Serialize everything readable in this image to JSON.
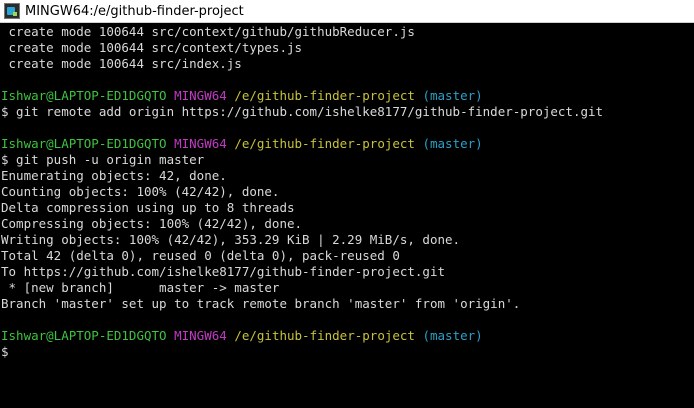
{
  "window": {
    "title": "MINGW64:/e/github-finder-project"
  },
  "colors": {
    "user": "#3fc23f",
    "system": "#c23ac2",
    "path": "#c8c23a",
    "branch": "#2aa0c8",
    "text": "#d9d9d9",
    "background": "#000000"
  },
  "terminal": {
    "commit_output": [
      " create mode 100644 src/context/github/githubReducer.js",
      " create mode 100644 src/context/types.js",
      " create mode 100644 src/index.js"
    ],
    "prompt1": {
      "user": "Ishwar@LAPTOP-ED1DGQTO",
      "system": "MINGW64",
      "path": "/e/github-finder-project",
      "branch": "(master)",
      "command": "$ git remote add origin https://github.com/ishelke8177/github-finder-project.git"
    },
    "prompt2": {
      "user": "Ishwar@LAPTOP-ED1DGQTO",
      "system": "MINGW64",
      "path": "/e/github-finder-project",
      "branch": "(master)",
      "command": "$ git push -u origin master"
    },
    "push_output": [
      "Enumerating objects: 42, done.",
      "Counting objects: 100% (42/42), done.",
      "Delta compression using up to 8 threads",
      "Compressing objects: 100% (42/42), done.",
      "Writing objects: 100% (42/42), 353.29 KiB | 2.29 MiB/s, done.",
      "Total 42 (delta 0), reused 0 (delta 0), pack-reused 0",
      "To https://github.com/ishelke8177/github-finder-project.git",
      " * [new branch]      master -> master",
      "Branch 'master' set up to track remote branch 'master' from 'origin'."
    ],
    "prompt3": {
      "user": "Ishwar@LAPTOP-ED1DGQTO",
      "system": "MINGW64",
      "path": "/e/github-finder-project",
      "branch": "(master)",
      "command": "$"
    }
  }
}
